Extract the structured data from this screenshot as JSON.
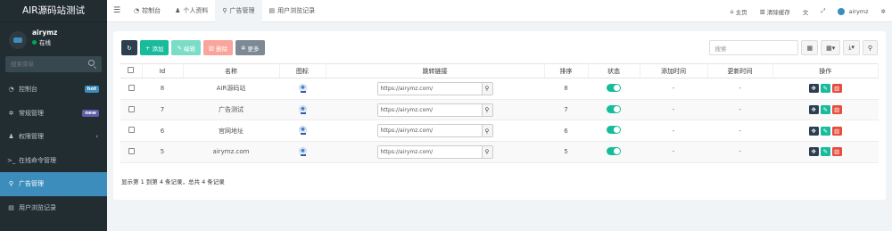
{
  "app": {
    "title": "AIR源码站测试"
  },
  "user": {
    "name": "airymz",
    "status": "在线"
  },
  "sidebar": {
    "search_placeholder": "搜索菜单",
    "items": [
      {
        "label": "控制台",
        "icon": "dashboard-icon",
        "badge": "hot",
        "active": false
      },
      {
        "label": "常规管理",
        "icon": "cogs-icon",
        "badge": "new",
        "active": false
      },
      {
        "label": "权限管理",
        "icon": "group-icon",
        "arrow": "‹",
        "active": false
      },
      {
        "label": "在线命令管理",
        "icon": "terminal-icon",
        "active": false
      },
      {
        "label": "广告管理",
        "icon": "link-icon",
        "active": true
      },
      {
        "label": "用户浏览记录",
        "icon": "list-icon",
        "active": false
      }
    ]
  },
  "topnav": {
    "tabs": [
      {
        "label": "控制台",
        "icon": "dashboard-icon"
      },
      {
        "label": "个人资料",
        "icon": "user-icon"
      },
      {
        "label": "广告管理",
        "icon": "link-icon",
        "active": true
      },
      {
        "label": "用户浏览记录",
        "icon": "list-icon"
      }
    ],
    "right": [
      {
        "label": "主页",
        "icon": "home-icon"
      },
      {
        "label": "清除缓存",
        "icon": "trash-icon"
      },
      {
        "label": "",
        "icon": "language-icon"
      },
      {
        "label": "",
        "icon": "fullscreen-icon"
      },
      {
        "label": "airymz",
        "icon": "avatar-icon"
      },
      {
        "label": "",
        "icon": "settings-icon"
      }
    ]
  },
  "toolbar": {
    "add_label": "添加",
    "edit_label": "编辑",
    "delete_label": "删除",
    "more_label": "更多",
    "search_placeholder": "搜索"
  },
  "table": {
    "headers": [
      "Id",
      "名称",
      "图标",
      "跳转链接",
      "排序",
      "状态",
      "添加时间",
      "更新时间",
      "操作"
    ],
    "rows": [
      {
        "id": "8",
        "name": "AIR源码站",
        "link": "https://airymz.com/",
        "sort": "8",
        "add_time": "-",
        "update_time": "-"
      },
      {
        "id": "7",
        "name": "广告测试",
        "link": "https://airymz.com/",
        "sort": "7",
        "add_time": "-",
        "update_time": "-"
      },
      {
        "id": "6",
        "name": "官网地址",
        "link": "https://airymz.com/",
        "sort": "6",
        "add_time": "-",
        "update_time": "-"
      },
      {
        "id": "5",
        "name": "airymz.com",
        "link": "https://airymz.com/",
        "sort": "5",
        "add_time": "-",
        "update_time": "-"
      }
    ]
  },
  "pagination": {
    "summary": "显示第 1 到第 4 条记录，总共 4 条记录"
  },
  "colors": {
    "sidebar_bg": "#222d32",
    "active": "#3c8dbc",
    "success": "#18bc9c",
    "danger": "#e74c3c",
    "dark": "#2c3e50"
  }
}
